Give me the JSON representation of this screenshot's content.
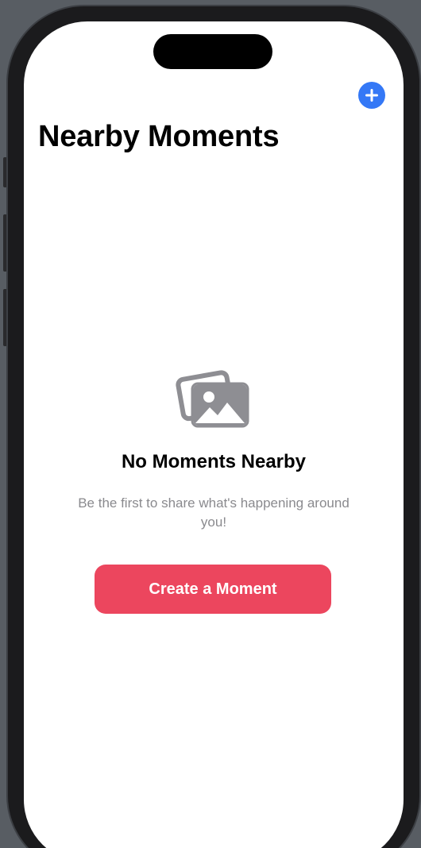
{
  "header": {
    "title": "Nearby Moments",
    "add_icon": "plus-circle-icon",
    "accent_color": "#3478f6"
  },
  "empty_state": {
    "icon": "photo-stack-icon",
    "title": "No Moments Nearby",
    "subtitle": "Be the first to share what's happening around you!",
    "button_label": "Create a Moment",
    "button_color": "#ec465e"
  }
}
